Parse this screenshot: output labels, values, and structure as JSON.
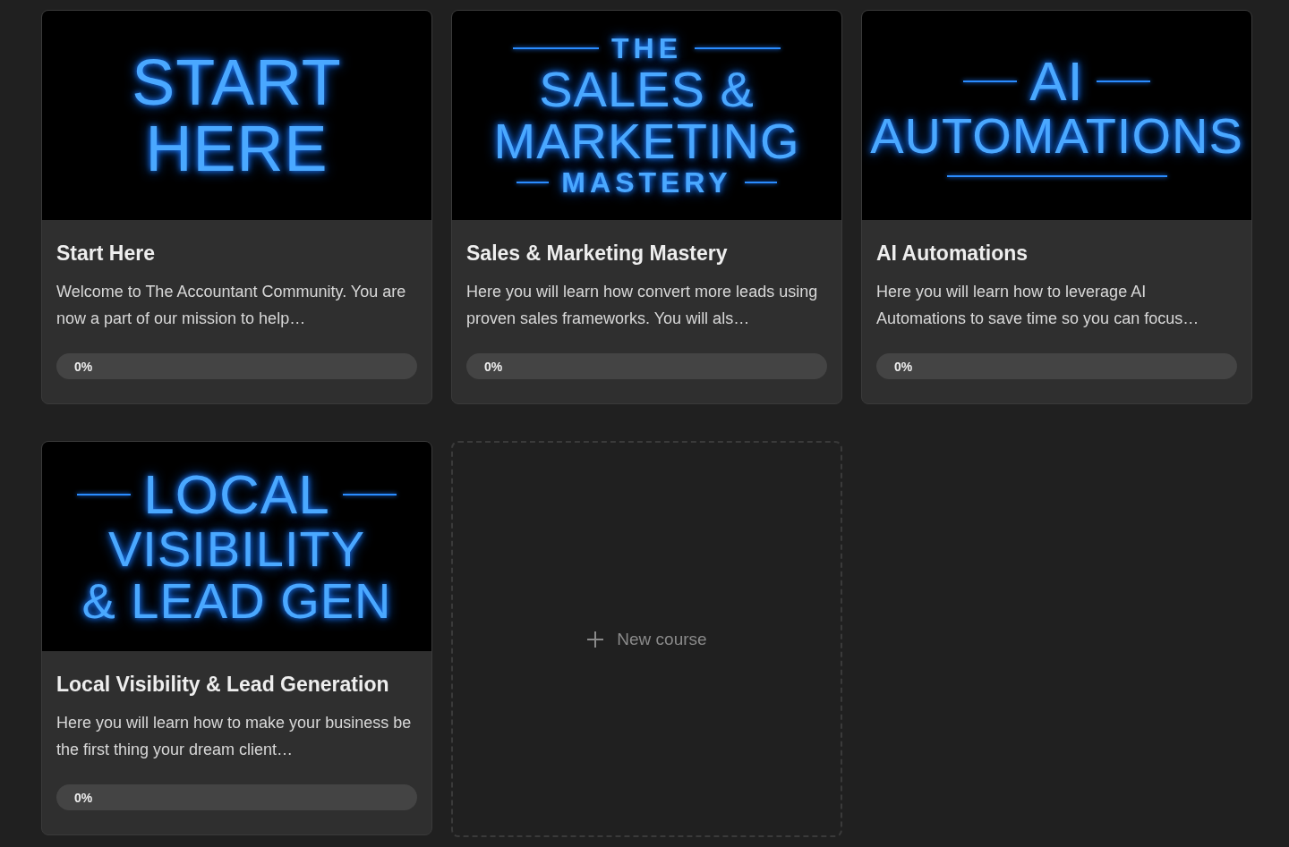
{
  "courses": [
    {
      "cover": [
        {
          "kind": "large",
          "text": "START"
        },
        {
          "kind": "large",
          "text": "HERE"
        }
      ],
      "title": "Start Here",
      "description": "Welcome to The Accountant Community. You are now a part of our mission to help…",
      "progress": {
        "label": "0%",
        "level": 0
      }
    },
    {
      "cover": [
        {
          "kind": "small",
          "text": "THE"
        },
        {
          "kind": "medium",
          "text": "SALES &"
        },
        {
          "kind": "medium",
          "text": "MARKETING"
        },
        {
          "kind": "small",
          "text": "MASTERY"
        }
      ],
      "title": "Sales & Marketing Mastery",
      "description": "Here you will learn how convert more leads using proven sales frameworks. You will als…",
      "progress": {
        "label": "0%",
        "level": 0
      }
    },
    {
      "cover": [
        {
          "kind": "ruled",
          "text": "AI"
        },
        {
          "kind": "medium",
          "text": "AUTOMATIONS"
        },
        {
          "kind": "rule"
        }
      ],
      "title": "AI Automations",
      "description": "Here you will learn how to leverage AI Automations to save time so you can focus…",
      "progress": {
        "label": "0%",
        "level": 0
      }
    },
    {
      "cover": [
        {
          "kind": "ruled",
          "text": "LOCAL"
        },
        {
          "kind": "medium",
          "text": "VISIBILITY"
        },
        {
          "kind": "medium",
          "text": "& LEAD GEN"
        }
      ],
      "title": "Local Visibility & Lead Generation",
      "description": "Here you will learn how to make your business be the first thing your dream client…",
      "progress": {
        "label": "0%",
        "level": 0
      }
    }
  ],
  "new_course": {
    "label": "New course"
  }
}
